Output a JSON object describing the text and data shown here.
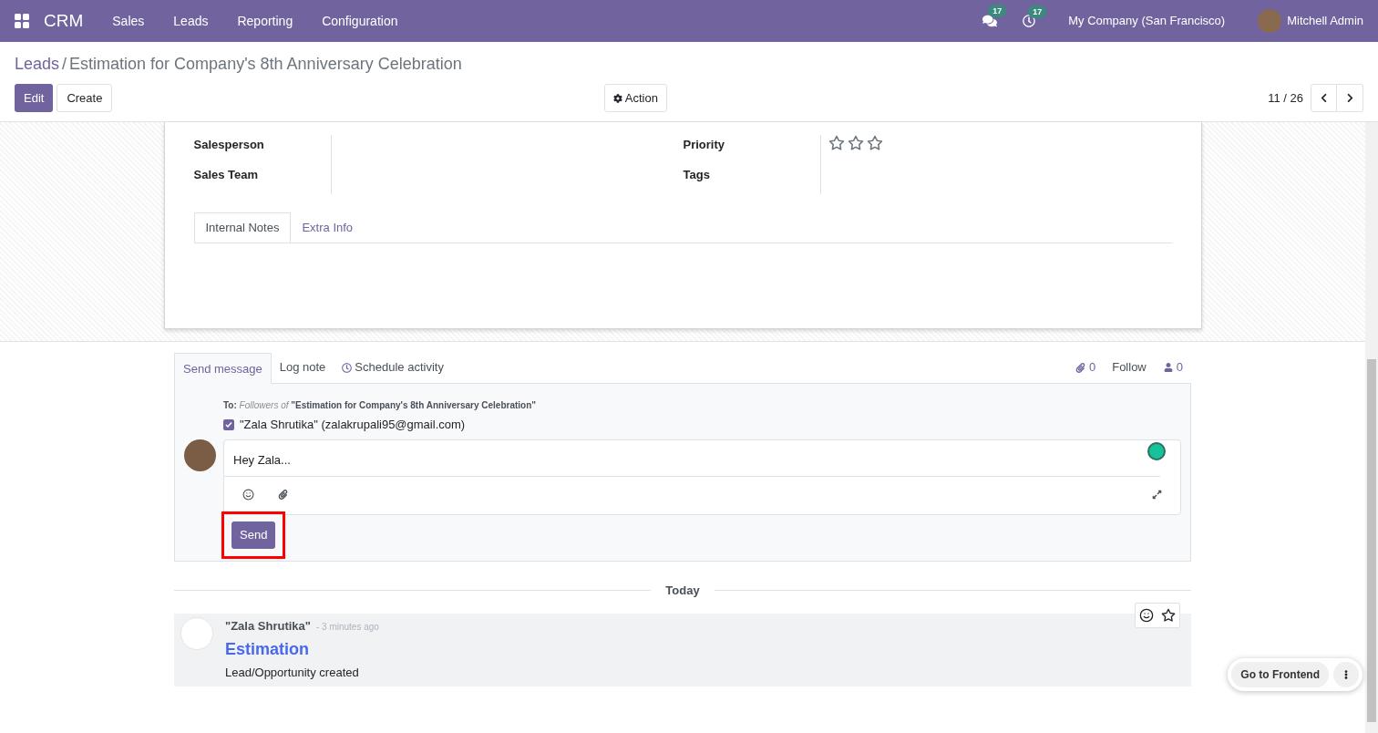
{
  "navbar": {
    "app": "CRM",
    "menu": [
      "Sales",
      "Leads",
      "Reporting",
      "Configuration"
    ],
    "messages_count": "17",
    "activities_count": "17",
    "company": "My Company (San Francisco)",
    "user": "Mitchell Admin"
  },
  "breadcrumb": {
    "parent": "Leads",
    "separator": "/",
    "current": "Estimation for Company's 8th Anniversary Celebration"
  },
  "buttons": {
    "edit": "Edit",
    "create": "Create",
    "action": "Action"
  },
  "pager": "11 / 26",
  "form": {
    "left_fields": [
      {
        "label": "Salesperson"
      },
      {
        "label": "Sales Team"
      }
    ],
    "right_fields": [
      {
        "label": "Priority",
        "kind": "stars",
        "stars": 0
      },
      {
        "label": "Tags",
        "kind": "empty"
      }
    ],
    "tabs": [
      {
        "label": "Internal Notes",
        "selected": true
      },
      {
        "label": "Extra Info",
        "selected": false
      }
    ]
  },
  "chatter": {
    "tabs": [
      {
        "label": "Send message",
        "selected": true,
        "kind": "plain"
      },
      {
        "label": "Log note",
        "selected": false,
        "kind": "plain"
      },
      {
        "label": "Schedule activity",
        "selected": false,
        "kind": "clock"
      }
    ],
    "attachments_count": "0",
    "follow": "Follow",
    "followers_count": "0",
    "to_label": "To:",
    "followers_of": "Followers of",
    "record": "\"Estimation for Company's 8th Anniversary Celebration\"",
    "recipient": {
      "label": "\"Zala Shrutika\" (zalakrupali95@gmail.com)",
      "checked": true
    },
    "message": "Hey Zala...",
    "send": "Send",
    "highlighted": true,
    "separator": "Today",
    "messages": [
      {
        "author": "\"Zala Shrutika\"",
        "time": "- 3 minutes ago",
        "title": "Estimation",
        "body": "Lead/Opportunity created"
      }
    ]
  },
  "frontend_button": "Go to Frontend"
}
